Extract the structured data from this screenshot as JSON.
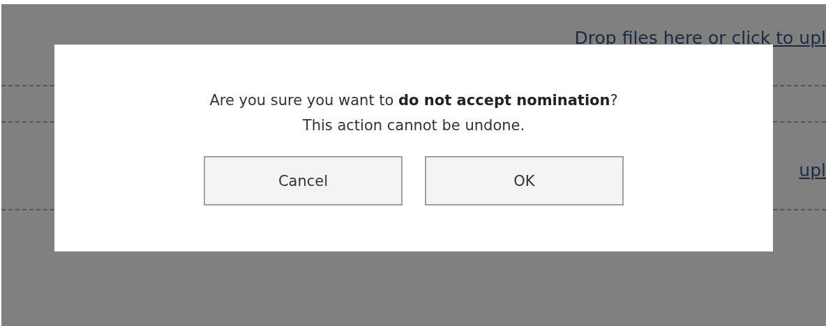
{
  "background": {
    "upload_links": [
      "Drop files here or click to upl",
      "upl"
    ]
  },
  "dialog": {
    "message": "Are you sure you want to **do not accept nomination**?",
    "note": "This action cannot be undone.",
    "buttons": [
      {
        "label": "Cancel"
      },
      {
        "label": "OK"
      }
    ]
  }
}
